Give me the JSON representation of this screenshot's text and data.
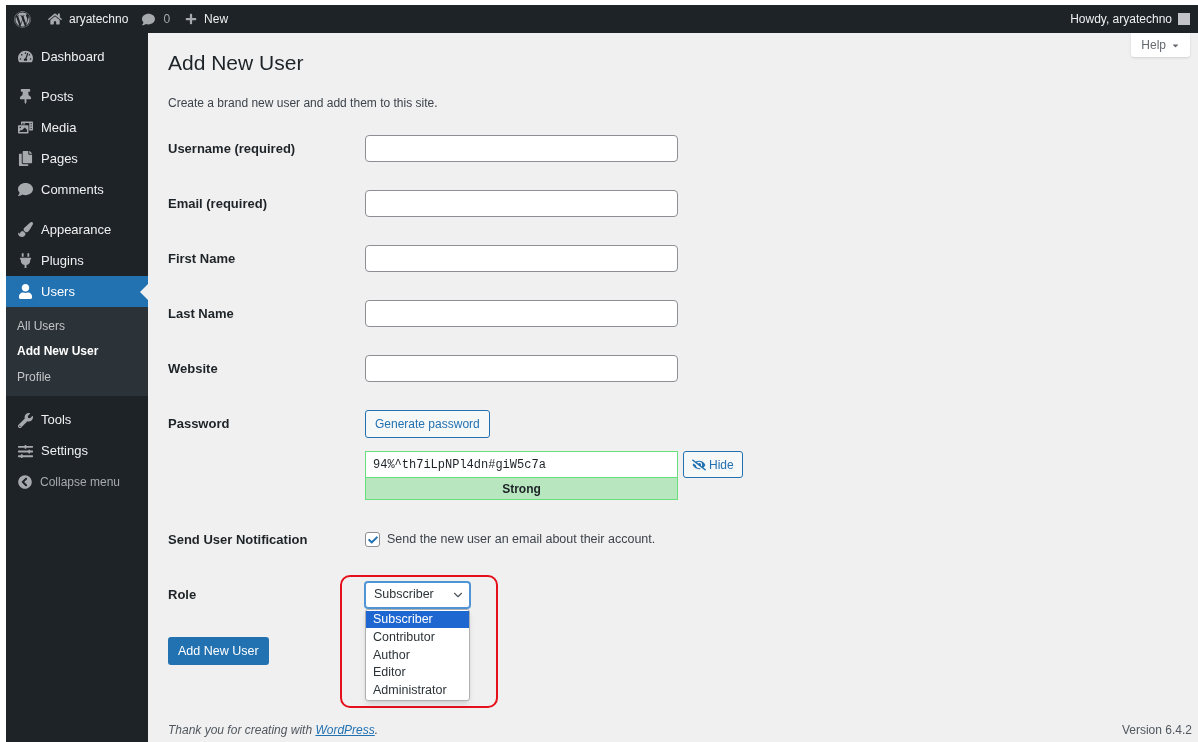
{
  "admin_bar": {
    "site": "aryatechno",
    "comments": "0",
    "new": "New",
    "greeting": "Howdy, aryatechno"
  },
  "sidebar": {
    "items": [
      {
        "label": "Dashboard",
        "selected": false
      },
      {
        "label": "Posts",
        "selected": false
      },
      {
        "label": "Media",
        "selected": false
      },
      {
        "label": "Pages",
        "selected": false
      },
      {
        "label": "Comments",
        "selected": false
      },
      {
        "label": "Appearance",
        "selected": false
      },
      {
        "label": "Plugins",
        "selected": false
      },
      {
        "label": "Users",
        "selected": true,
        "children": [
          {
            "label": "All Users",
            "selected": false
          },
          {
            "label": "Add New User",
            "selected": true
          },
          {
            "label": "Profile",
            "selected": false
          }
        ]
      },
      {
        "label": "Tools",
        "selected": false
      },
      {
        "label": "Settings",
        "selected": false
      }
    ],
    "collapse": "Collapse menu"
  },
  "help": "Help",
  "page": {
    "title": "Add New User",
    "description": "Create a brand new user and add them to this site."
  },
  "form": {
    "fields": [
      {
        "kind": "text",
        "label": "Username (required)"
      },
      {
        "kind": "text",
        "label": "Email (required)"
      },
      {
        "kind": "text",
        "label": "First Name"
      },
      {
        "kind": "text",
        "label": "Last Name"
      },
      {
        "kind": "text",
        "label": "Website"
      },
      {
        "kind": "password",
        "label": "Password",
        "generate": "Generate password",
        "value": "94%^th7iLpNPl4dn#giW5c7a",
        "toggle": "Hide",
        "strength": "Strong"
      },
      {
        "kind": "checkbox",
        "label": "Send User Notification",
        "checked": true,
        "text": "Send the new user an email about their account."
      },
      {
        "kind": "select",
        "label": "Role",
        "value": "Subscriber",
        "expanded": true,
        "options": [
          {
            "label": "Subscriber",
            "selected": true
          },
          {
            "label": "Contributor",
            "selected": false
          },
          {
            "label": "Author",
            "selected": false
          },
          {
            "label": "Editor",
            "selected": false
          },
          {
            "label": "Administrator",
            "selected": false
          }
        ]
      }
    ],
    "submit": "Add New User"
  },
  "footer": {
    "text": "Thank you for creating with",
    "link": "WordPress",
    "after": ".",
    "version": "Version 6.4.2"
  }
}
